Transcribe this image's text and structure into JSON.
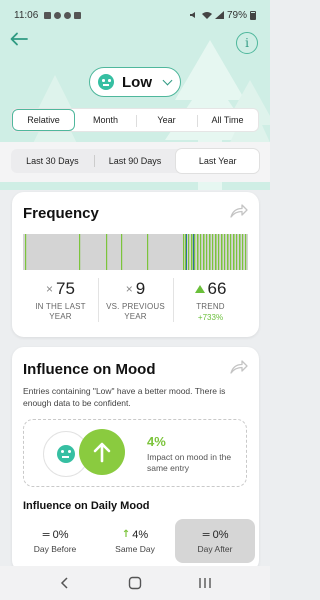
{
  "status_bar": {
    "time": "11:06",
    "battery": "79%"
  },
  "header": {
    "mood_label": "Low"
  },
  "range_tabs": [
    {
      "label": "Relative",
      "active": true
    },
    {
      "label": "Month",
      "active": false
    },
    {
      "label": "Year",
      "active": false
    },
    {
      "label": "All Time",
      "active": false
    }
  ],
  "period_tabs": [
    {
      "label": "Last 30 Days",
      "active": false
    },
    {
      "label": "Last 90 Days",
      "active": false
    },
    {
      "label": "Last Year",
      "active": true
    }
  ],
  "frequency": {
    "title": "Frequency",
    "stats": [
      {
        "symbol": "×",
        "value": "75",
        "caption": "IN THE LAST YEAR"
      },
      {
        "symbol": "×",
        "value": "9",
        "caption": "VS. PREVIOUS YEAR"
      },
      {
        "symbol": "up-triangle",
        "value": "66",
        "caption": "TREND",
        "change": "+733%"
      }
    ]
  },
  "influence": {
    "title": "Influence on Mood",
    "description": "Entries containing \"Low\" have a better mood. There is enough data to be confident.",
    "impact_value": "4%",
    "impact_caption": "Impact on mood in the same entry",
    "daily_title": "Influence on Daily Mood",
    "daily": [
      {
        "symbol": "=",
        "value": "0%",
        "label": "Day Before",
        "selected": false
      },
      {
        "symbol": "↑",
        "value": "4%",
        "label": "Same Day",
        "selected": false
      },
      {
        "symbol": "=",
        "value": "0%",
        "label": "Day After",
        "selected": true
      }
    ]
  },
  "colors": {
    "accent": "#4fb79c",
    "positive": "#7cc43c",
    "hero_bg": "#cfeee5"
  },
  "icons": [
    "back-arrow-icon",
    "info-icon",
    "chevron-down-icon",
    "share-icon",
    "up-arrow-icon",
    "nav-back-icon",
    "nav-home-icon",
    "nav-recents-icon"
  ]
}
